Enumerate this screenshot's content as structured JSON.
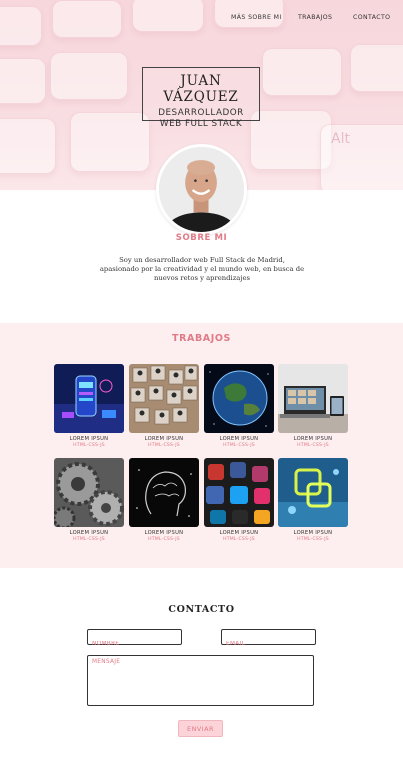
{
  "nav": {
    "items": [
      "MÁS SOBRE MI",
      "TRABAJOS",
      "CONTACTO"
    ]
  },
  "hero": {
    "name": "JUAN VÁZQUEZ",
    "role_line1": "DESARROLLADOR",
    "role_line2": "WEB FULL STACK"
  },
  "about": {
    "title": "SOBRE MI",
    "line1": "Soy un desarrollador web Full Stack de Madrid,",
    "line2": "apasionado por la creatividad y el mundo web, en busca de",
    "line3": "nuevos retos y aprendizajes"
  },
  "works": {
    "title": "TRABAJOS",
    "items": [
      {
        "title": "LOREM IPSUN",
        "tags": "HTML-CSS-JS",
        "image": "phone-app"
      },
      {
        "title": "LOREM IPSUN",
        "tags": "HTML-CSS-JS",
        "image": "people-network"
      },
      {
        "title": "LOREM IPSUN",
        "tags": "HTML-CSS-JS",
        "image": "earth"
      },
      {
        "title": "LOREM IPSUN",
        "tags": "HTML-CSS-JS",
        "image": "laptop-tablet"
      },
      {
        "title": "LOREM IPSUN",
        "tags": "HTML-CSS-JS",
        "image": "gears"
      },
      {
        "title": "LOREM IPSUN",
        "tags": "HTML-CSS-JS",
        "image": "brain"
      },
      {
        "title": "LOREM IPSUN",
        "tags": "HTML-CSS-JS",
        "image": "social-apps"
      },
      {
        "title": "LOREM IPSUN",
        "tags": "HTML-CSS-JS",
        "image": "blockchain"
      }
    ]
  },
  "contact": {
    "title": "CONTACTO",
    "name_placeholder": "NOMBRE",
    "email_placeholder": "EMAIL",
    "message_placeholder": "MENSAJE",
    "send_label": "ENVIAR"
  },
  "colors": {
    "accent": "#e07b86",
    "hero_bg": "#f8dde1",
    "works_bg": "#fdeef0",
    "button_bg": "#fcd3d8"
  }
}
